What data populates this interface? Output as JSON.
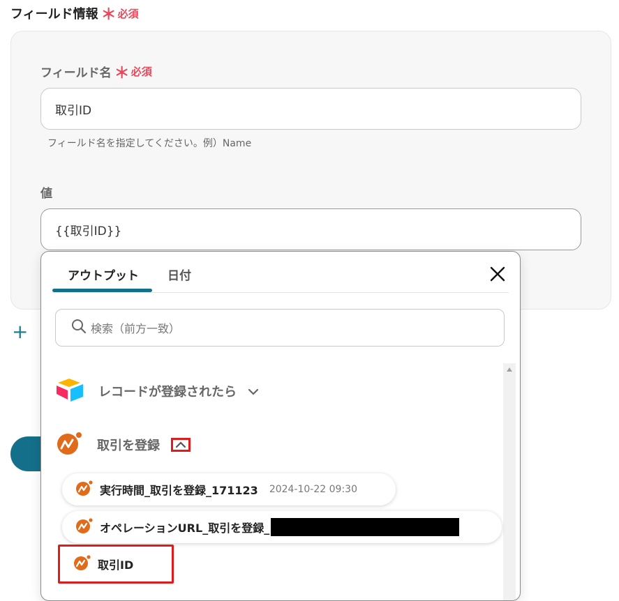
{
  "section": {
    "title": "フィールド情報",
    "required_star": "＊",
    "required_text": "必須"
  },
  "field_name": {
    "label": "フィールド名",
    "required_star": "＊",
    "required_text": "必須",
    "value": "取引ID",
    "hint": "フィールド名を指定してください。例）Name"
  },
  "value_field": {
    "label": "値",
    "value": "{{取引ID}}"
  },
  "add_button": {
    "symbol": "+"
  },
  "popup": {
    "tabs": [
      {
        "label": "アウトプット",
        "active": true
      },
      {
        "label": "日付",
        "active": false
      }
    ],
    "search_placeholder": "検索（前方一致）",
    "groups": [
      {
        "label": "レコードが登録されたら",
        "expanded": false,
        "icon": "airtable-icon"
      },
      {
        "label": "取引を登録",
        "expanded": true,
        "icon": "freee-icon"
      }
    ],
    "items": [
      {
        "label": "実行時間_取引を登録_171123",
        "meta": "2024-10-22 09:30"
      },
      {
        "label": "オペレーションURL_取引を登録_"
      },
      {
        "label": "取引ID"
      }
    ]
  },
  "colors": {
    "accent": "#14708a",
    "required": "#e8485a",
    "highlight": "#e01b1b",
    "freee": "#e06b1a"
  }
}
